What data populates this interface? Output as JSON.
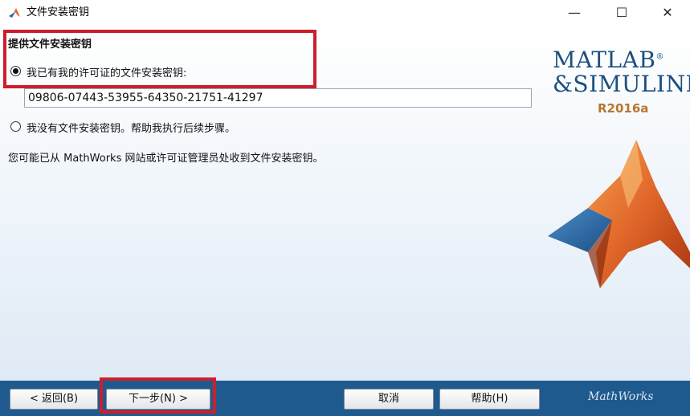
{
  "window": {
    "title": "文件安装密钥",
    "minimize_glyph": "—",
    "maximize_glyph": "☐",
    "close_glyph": "✕"
  },
  "section_title": "提供文件安装密钥",
  "options": {
    "have_key_label": "我已有我的许可证的文件安装密钥:",
    "have_key_selected": true,
    "no_key_label": "我没有文件安装密钥。帮助我执行后续步骤。",
    "no_key_selected": false
  },
  "key_input": {
    "value": "09806-07443-53955-64350-21751-41297"
  },
  "info_text": "您可能已从 MathWorks 网站或许可证管理员处收到文件安装密钥。",
  "logo": {
    "line1": "MATLAB",
    "line2": "&SIMULINK",
    "registered": "®",
    "release": "R2016a"
  },
  "buttons": {
    "back": "< 返回(B)",
    "next": "下一步(N) >",
    "cancel": "取消",
    "help": "帮助(H)"
  },
  "footer_brand": "MathWorks",
  "colors": {
    "highlight": "#cc1f2d",
    "bottom_bar": "#1f5a8f",
    "logo_blue": "#1c4f7e",
    "release_orange": "#b8762e"
  }
}
